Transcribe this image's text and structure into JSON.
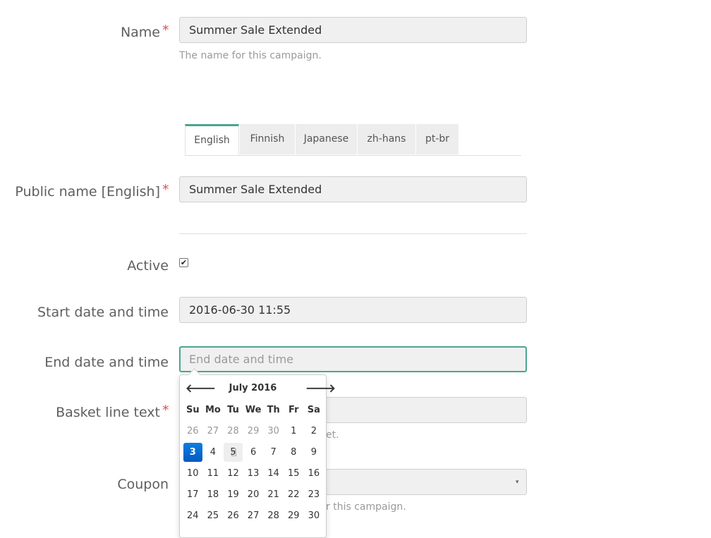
{
  "form": {
    "name": {
      "label": "Name",
      "required_mark": "*",
      "value": "Summer Sale Extended",
      "help": "The name for this campaign."
    },
    "tabs": [
      "English",
      "Finnish",
      "Japanese",
      "zh-hans",
      "pt-br"
    ],
    "public_name": {
      "label": "Public name [English]",
      "required_mark": "*",
      "value": "Summer Sale Extended"
    },
    "active": {
      "label": "Active",
      "checked_mark": "✔"
    },
    "start": {
      "label": "Start date and time",
      "value": "2016-06-30 11:55"
    },
    "end": {
      "label": "End date and time",
      "placeholder": "End date and time"
    },
    "basket": {
      "label": "Basket line text",
      "required_mark": "*",
      "help_tail": "et."
    },
    "coupon": {
      "label": "Coupon",
      "help_tail": "r this campaign.",
      "arrow": "▾"
    }
  },
  "datepicker": {
    "title": "July 2016",
    "prev": "🡐",
    "next": "🡒",
    "weekdays": [
      "Su",
      "Mo",
      "Tu",
      "We",
      "Th",
      "Fr",
      "Sa"
    ],
    "weeks": [
      [
        "26",
        "27",
        "28",
        "29",
        "30",
        "1",
        "2"
      ],
      [
        "3",
        "4",
        "5",
        "6",
        "7",
        "8",
        "9"
      ],
      [
        "10",
        "11",
        "12",
        "13",
        "14",
        "15",
        "16"
      ],
      [
        "17",
        "18",
        "19",
        "20",
        "21",
        "22",
        "23"
      ],
      [
        "24",
        "25",
        "26",
        "27",
        "28",
        "29",
        "30"
      ]
    ],
    "today": "3",
    "hovered": "5"
  },
  "colors": {
    "accent": "#4aa590",
    "required": "#d9534f",
    "today": "#0a6fd8"
  }
}
